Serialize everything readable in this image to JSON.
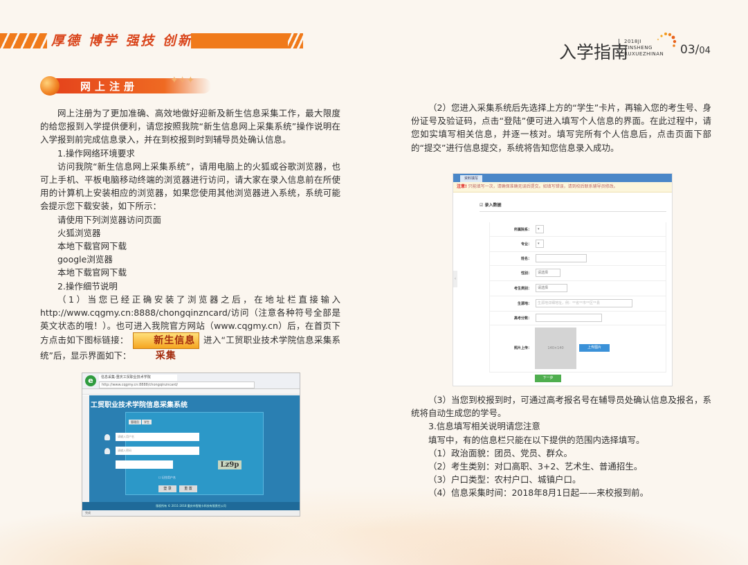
{
  "header": {
    "motto": "厚德 博学 强技 创新",
    "guide_title": "入学指南",
    "guide_sub_1": "2018JI",
    "guide_sub_2": "XINSHENG",
    "guide_sub_3": "RUXUEZHINAN",
    "page_current": "03/",
    "page_total": "04"
  },
  "section": {
    "title": "网上注册"
  },
  "left": {
    "intro": "网上注册为了更加准确、高效地做好迎新及新生信息采集工作，最大限度的给您报到入学提供便利，请您按照我院“新生信息网上采集系统”操作说明在入学报到前完成信息录入，并在到校报到时到辅导员处确认信息。",
    "h1": "1.操作网络环境要求",
    "p1": "访问我院“新生信息网上采集系统”，请用电脑上的火狐或谷歌浏览器，也可上手机、平板电脑移动终端的浏览器进行访问，请大家在录入信息前在所使用的计算机上安装相应的浏览器，如果您使用其他浏览器进入系统，系统可能会提示您下载安装，如下所示：",
    "l1": "请使用下列浏览器访问页面",
    "l2": "火狐浏览器",
    "l3": "本地下载官网下载",
    "l4": "google浏览器",
    "l5": "本地下载官网下载",
    "h2": "2.操作细节说明",
    "p2a": "（1）当您已经正确安装了浏览器之后，在地址栏直接输入http://www.cqgmy.cn:8888/chongqinzncard/访问（注意各种符号全部是英文状态的哦！）。也可进入我院官方网站（www.cqgmy.cn）后，在首页下方点击如下图标链接：",
    "button_label": "新生信息采集",
    "p2b": "进入“工贸职业技术学院信息采集系统”后，显示界面如下："
  },
  "shot1": {
    "logo": "e",
    "tab": "信息采集-重庆工贸职业技术学院",
    "url": "http://www.cqgmy.cn:8888/chongqinzncard/",
    "system_title": "工贸职业技术学院信息采集系统",
    "tab_a": "管理员",
    "tab_b": "学生",
    "user_placeholder": "请输入用户名",
    "pass_placeholder": "请输入密码",
    "captcha": "Lz9p",
    "remember": "记住用户名",
    "login": "登 录",
    "reset": "重 置",
    "footer": "版权所有 © 2011-2018 重庆市智能卡科技有限责任公司",
    "status": "完成"
  },
  "right": {
    "p1": "（2）您进入采集系统后先选择上方的“学生”卡片，再输入您的考生号、身份证号及验证码，点击“登陆”便可进入填写个人信息的界面。在此过程中，请您如实填写相关信息，并逐一核对。填写完所有个人信息后，点击页面下部的“提交”进行信息提交，系统将告知您信息录入成功。",
    "p2": "（3）当您到校报到时，可通过高考报名号在辅导员处确认信息及报名，系统将自动生成您的学号。",
    "h3": "3.信息填写相关说明请您注意",
    "p3": "填写中，有的信息栏只能在以下提供的范围内选择填写。",
    "li1": "（1）政治面貌：团员、党员、群众。",
    "li2": "（2）考生类别：对口高职、3+2、艺术生、普通招生。",
    "li3": "（3）户口类型：农村户口、城镇户口。",
    "li4": "（4）信息采集时间：2018年8月1日起——来校报到前。"
  },
  "shot2": {
    "tab": "资料填写",
    "note_label": "注意!",
    "note_text": "只能填写一次，请确保准确无误后提交。如填写错误，请到校后联系辅导员修改。",
    "section_title": "录入数据",
    "fields": [
      {
        "label": "所属院系：",
        "value": ""
      },
      {
        "label": "专业：",
        "value": ""
      },
      {
        "label": "姓名：",
        "value": ""
      },
      {
        "label": "性别：",
        "value": "请选择"
      },
      {
        "label": "考生类别：",
        "value": "请选择"
      },
      {
        "label": "生源地：",
        "value": "生源地详细地址，例：**省**市**区**县"
      },
      {
        "label": "高考分数：",
        "value": ""
      },
      {
        "label": "照片上传：",
        "value": ""
      }
    ],
    "photo": "140×140",
    "upload": "上传图片",
    "next": "下一步"
  }
}
